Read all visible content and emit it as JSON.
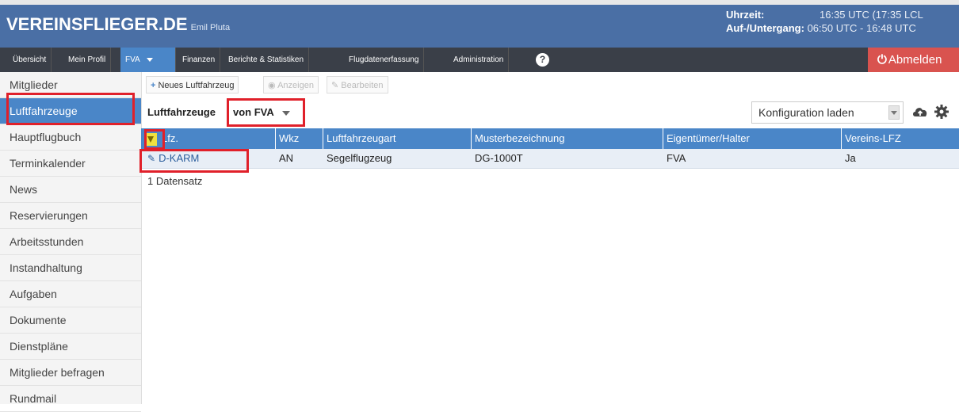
{
  "header": {
    "brand": "VEREINSFLIEGER.DE",
    "user": "Emil Pluta",
    "time_label": "Uhrzeit:",
    "time_value": "16:35 UTC (17:35 LCL",
    "sun_label": "Auf-/Untergang:",
    "sun_value": "06:50 UTC - 16:48 UTC"
  },
  "nav": {
    "items": [
      {
        "label": "Übersicht"
      },
      {
        "label": "Mein Profil"
      },
      {
        "label": "FVA"
      },
      {
        "label": "Finanzen"
      },
      {
        "label": "Berichte & Statistiken"
      },
      {
        "label": "Flugdatenerfassung"
      },
      {
        "label": "Administration"
      }
    ],
    "help_icon": "question-circle-icon",
    "logout_label": "Abmelden"
  },
  "sidebar": {
    "items": [
      {
        "label": "Mitglieder"
      },
      {
        "label": "Luftfahrzeuge"
      },
      {
        "label": "Hauptflugbuch"
      },
      {
        "label": "Terminkalender"
      },
      {
        "label": "News"
      },
      {
        "label": "Reservierungen"
      },
      {
        "label": "Arbeitsstunden"
      },
      {
        "label": "Instandhaltung"
      },
      {
        "label": "Aufgaben"
      },
      {
        "label": "Dokumente"
      },
      {
        "label": "Dienstpläne"
      },
      {
        "label": "Mitglieder befragen"
      },
      {
        "label": "Rundmail"
      }
    ],
    "active": "Luftfahrzeuge"
  },
  "toolbar": {
    "new_label": "Neues Luftfahrzeug",
    "show_label": "Anzeigen",
    "edit_label": "Bearbeiten"
  },
  "list": {
    "title": "Luftfahrzeuge",
    "filter_value": "von FVA",
    "config_placeholder": "Konfiguration laden",
    "columns": [
      "Lfz.",
      "Wkz",
      "Luftfahrzeugart",
      "Musterbezeichnung",
      "Eigentümer/Halter",
      "Vereins-LFZ"
    ],
    "rows": [
      {
        "lfz": "D-KARM",
        "wkz": "AN",
        "art": "Segelflugzeug",
        "muster": "DG-1000T",
        "eigentuemer": "FVA",
        "verein": "Ja"
      }
    ],
    "record_count": "1 Datensatz"
  },
  "colors": {
    "header_bg": "#4a6fa5",
    "nav_bg": "#3a3f48",
    "accent": "#4a86c8",
    "logout_bg": "#d9534f",
    "highlight": "#e0202a"
  }
}
